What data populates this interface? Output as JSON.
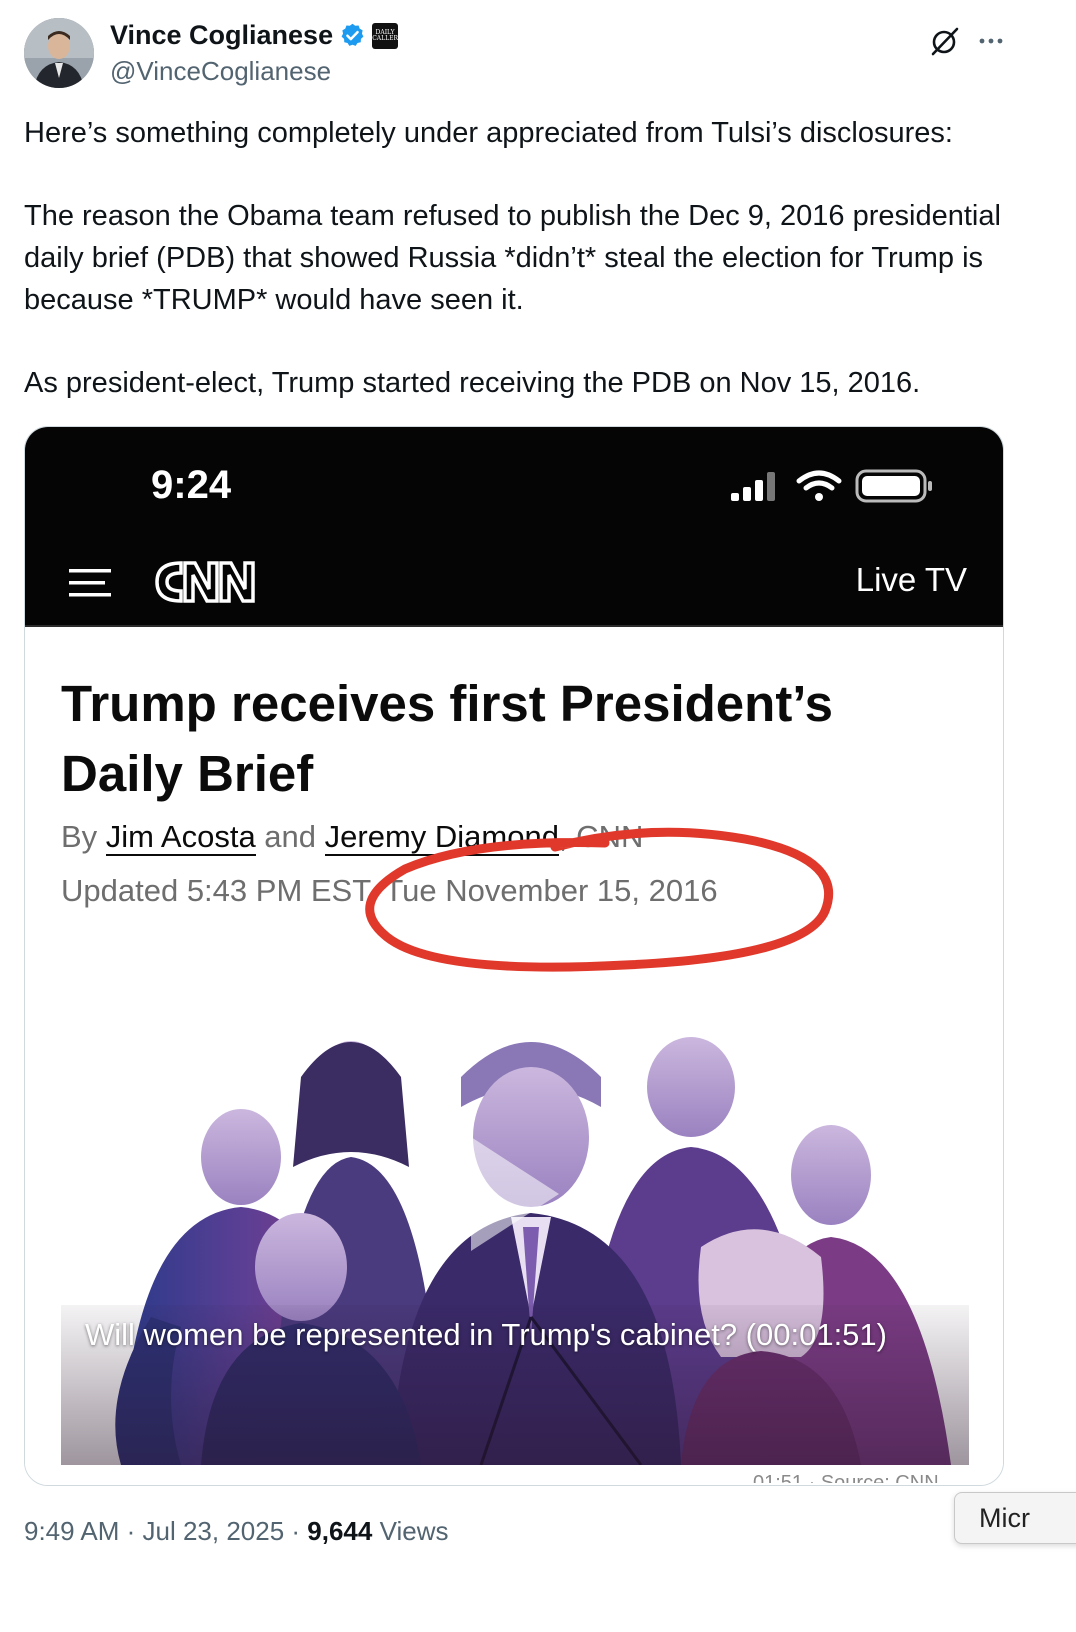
{
  "author": {
    "display_name": "Vince Coglianese",
    "handle": "@VinceCoglianese",
    "affiliate_badge_text": [
      "DAILY",
      "CALLER"
    ]
  },
  "icons": {
    "verified": "verified-badge-icon",
    "grok": "grok-icon",
    "more": "more-options-icon",
    "play": "play-icon",
    "menu": "hamburger-menu-icon"
  },
  "tweet": {
    "paragraphs": [
      "Here’s something completely under appreciated from Tulsi’s disclosures:",
      "The reason the Obama team refused to publish the Dec 9, 2016 presidential daily brief (PDB) that showed Russia *didn’t* steal the election for Trump is because *TRUMP* would have seen it.",
      "As president-elect, Trump started receiving the PDB on Nov 15, 2016."
    ]
  },
  "screenshot": {
    "status_time": "9:24",
    "nav": {
      "logo": "CNN",
      "live_tv": "Live TV"
    },
    "article": {
      "headline": "Trump receives first President’s Daily Brief",
      "byline_prefix": "By ",
      "author_1": "Jim Acosta",
      "byline_and": " and ",
      "author_2": "Jeremy Diamond",
      "byline_suffix": ", CNN",
      "updated": "Updated 5:43 PM EST, Tue November 15, 2016"
    },
    "video": {
      "caption": "Will women be represented in Trump's cabinet? (00:01:51)",
      "source_line": "01:51 · Source: CNN"
    },
    "annotation_color": "#e0392b"
  },
  "footer": {
    "time": "9:49 AM · Jul 23, 2025 · ",
    "views_count": "9,644",
    "views_label": " Views"
  },
  "side_tab": {
    "label": "Micr"
  },
  "colors": {
    "text": "#0f1419",
    "secondary": "#536471",
    "verified": "#1d9bf0",
    "border": "#cfd9de"
  }
}
